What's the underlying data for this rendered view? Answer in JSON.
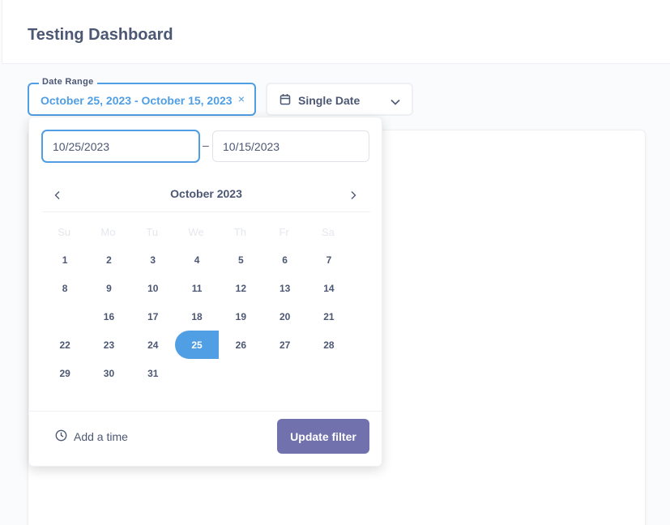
{
  "header": {
    "title": "Testing Dashboard"
  },
  "filters": {
    "date_range": {
      "legend": "Date Range",
      "value": "October 25, 2023 - October 15, 2023",
      "clear_icon": "×"
    },
    "single_date": {
      "label": "Single Date",
      "icon": "calendar-icon"
    }
  },
  "picker": {
    "start_input": "10/25/2023",
    "end_input": "10/15/2023",
    "separator": "–",
    "month_label": "October 2023",
    "weekdays": [
      "Su",
      "Mo",
      "Tu",
      "We",
      "Th",
      "Fr",
      "Sa"
    ],
    "days": [
      "1",
      "2",
      "3",
      "4",
      "5",
      "6",
      "7",
      "8",
      "9",
      "10",
      "11",
      "12",
      "13",
      "14",
      "",
      "16",
      "17",
      "18",
      "19",
      "20",
      "21",
      "22",
      "23",
      "24",
      "25",
      "26",
      "27",
      "28",
      "29",
      "30",
      "31",
      "",
      "",
      "",
      ""
    ],
    "selected_day": "25",
    "add_time_label": "Add a time",
    "update_label": "Update filter"
  },
  "colors": {
    "accent": "#509ee3",
    "primary_button": "#7172ad",
    "text": "#4c5773"
  }
}
